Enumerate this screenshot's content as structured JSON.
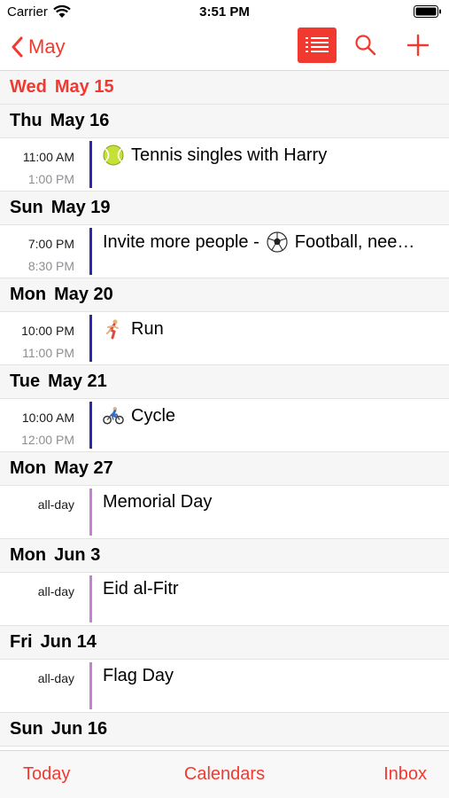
{
  "status_bar": {
    "carrier": "Carrier",
    "time": "3:51 PM"
  },
  "nav": {
    "back_label": "May"
  },
  "today_header": {
    "dow": "Wed",
    "date": "May 15"
  },
  "days": [
    {
      "dow": "Thu",
      "date": "May 16",
      "events": [
        {
          "start": "11:00 AM",
          "end": "1:00 PM",
          "title": "Tennis singles with Harry",
          "calendar_color": "#2a2ab0",
          "emoji": "tennis-ball-icon"
        }
      ]
    },
    {
      "dow": "Sun",
      "date": "May 19",
      "events": [
        {
          "start": "7:00 PM",
          "end": "8:30 PM",
          "title_prefix": "Invite more people -",
          "title": "Football, nee…",
          "calendar_color": "#2a2ab0",
          "emoji": "soccer-ball-icon"
        }
      ]
    },
    {
      "dow": "Mon",
      "date": "May 20",
      "events": [
        {
          "start": "10:00 PM",
          "end": "11:00 PM",
          "title": "Run",
          "calendar_color": "#2a2ab0",
          "emoji": "runner-icon"
        }
      ]
    },
    {
      "dow": "Tue",
      "date": "May 21",
      "events": [
        {
          "start": "10:00 AM",
          "end": "12:00 PM",
          "title": "Cycle",
          "calendar_color": "#2a2ab0",
          "emoji": "cyclist-icon"
        }
      ]
    },
    {
      "dow": "Mon",
      "date": "May 27",
      "events": [
        {
          "allday": "all-day",
          "title": "Memorial Day",
          "calendar_color": "#c77fd6"
        }
      ]
    },
    {
      "dow": "Mon",
      "date": "Jun 3",
      "events": [
        {
          "allday": "all-day",
          "title": "Eid al-Fitr",
          "calendar_color": "#c77fd6"
        }
      ]
    },
    {
      "dow": "Fri",
      "date": "Jun 14",
      "events": [
        {
          "allday": "all-day",
          "title": "Flag Day",
          "calendar_color": "#c77fd6"
        }
      ]
    },
    {
      "dow": "Sun",
      "date": "Jun 16",
      "events": []
    }
  ],
  "tabbar": {
    "today": "Today",
    "calendars": "Calendars",
    "inbox": "Inbox"
  },
  "colors": {
    "accent": "#f2392f"
  }
}
